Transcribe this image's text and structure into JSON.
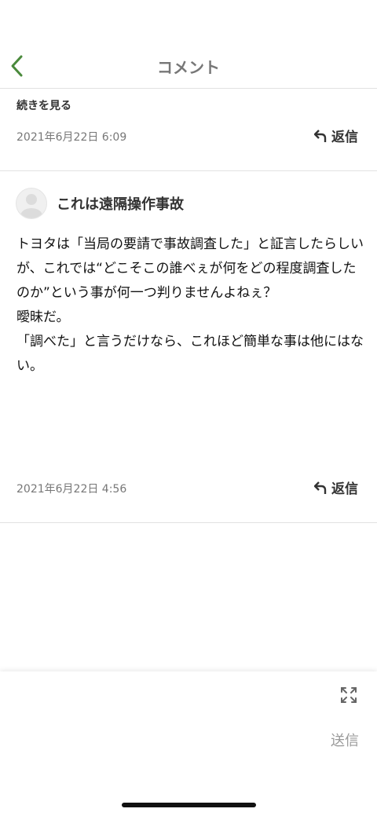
{
  "header": {
    "title": "コメント"
  },
  "thread_top": {
    "more_label": "続きを見る",
    "timestamp": "2021年6月22日 6:09",
    "reply_label": "返信"
  },
  "comment": {
    "author": "これは遠隔操作事故",
    "body": "トヨタは「当局の要請で事故調査した」と証言したらしいが、これでは“どこそこの誰べぇが何をどの程度調査したのか”という事が何一つ判りませんよねぇ？\n曖昧だ。\n「調べた」と言うだけなら、これほど簡単な事は他にはない。",
    "timestamp": "2021年6月22日 4:56",
    "reply_label": "返信"
  },
  "composer": {
    "send_label": "送信"
  },
  "colors": {
    "accent": "#4a8a3c",
    "muted": "#777777"
  }
}
